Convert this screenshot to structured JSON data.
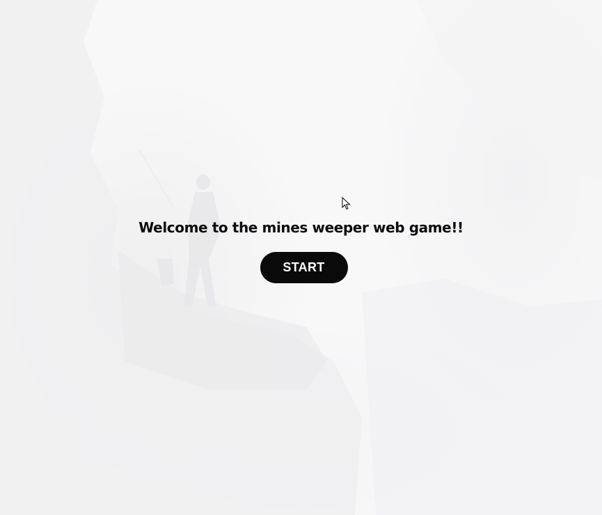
{
  "welcome": {
    "title": "Welcome to the mines weeper web game!!",
    "start_label": "START"
  },
  "background": {
    "scene": "misty-cliff-hiker-image",
    "base_color": "#f8f8f9"
  },
  "colors": {
    "title_text": "#0b0b0d",
    "button_bg": "#0a0a0b",
    "button_text": "#ffffff"
  },
  "icons": {
    "cursor": "mouse-pointer-icon"
  }
}
